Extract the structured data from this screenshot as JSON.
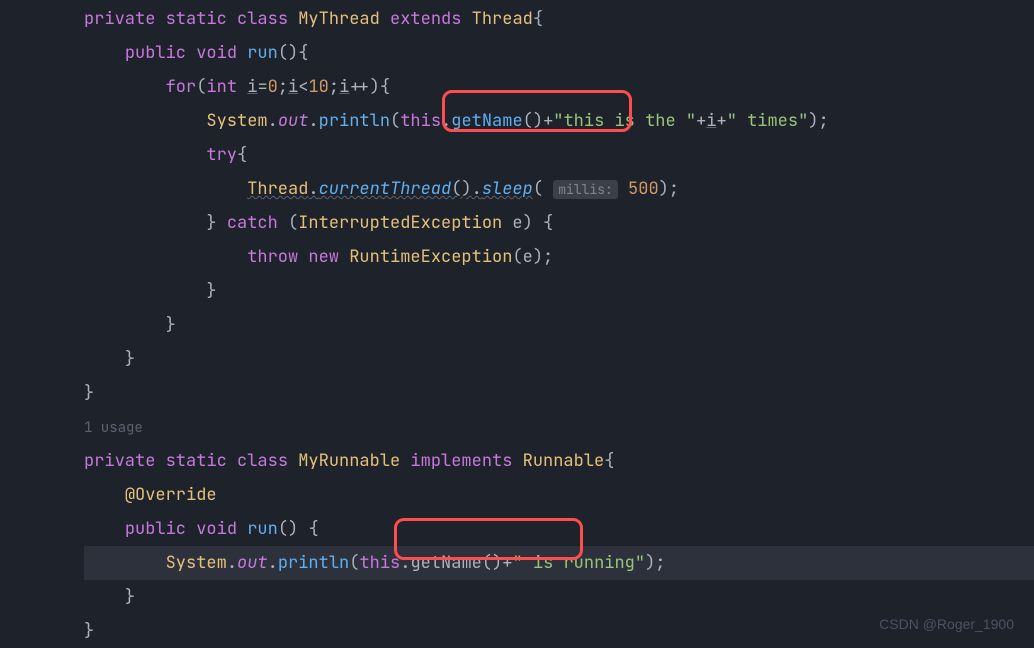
{
  "code": {
    "l1_private": "private",
    "l1_static": "static",
    "l1_class": "class",
    "l1_mythread": "MyThread",
    "l1_extends": "extends",
    "l1_thread": "Thread",
    "l1_brace": "{",
    "l2_public": "public",
    "l2_void": "void",
    "l2_run": "run",
    "l2_parens": "(){",
    "l3_for": "for",
    "l3_int": "int",
    "l3_i": "i",
    "l3_eq": "=",
    "l3_zero": "0",
    "l3_sc1": ";",
    "l3_i2": "i",
    "l3_lt": "<",
    "l3_ten": "10",
    "l3_sc2": ";",
    "l3_i3": "i",
    "l3_pp": "++){",
    "l4_system": "System",
    "l4_dot1": ".",
    "l4_out": "out",
    "l4_dot2": ".",
    "l4_println": "println",
    "l4_open": "(",
    "l4_this": "this",
    "l4_dot3": ".",
    "l4_getname": "getName",
    "l4_call": "()",
    "l4_plus1": "+",
    "l4_str1": "\"this is the \"",
    "l4_plus2": "+",
    "l4_i": "i",
    "l4_plus3": "+",
    "l4_str2": "\" times\"",
    "l4_close": ");",
    "l5_try": "try",
    "l5_brace": "{",
    "l6_thread": "Thread",
    "l6_dot1": ".",
    "l6_current": "currentThread",
    "l6_call1": "()",
    "l6_dot2": ".",
    "l6_sleep": "sleep",
    "l6_open": "(",
    "l6_millis": "millis:",
    "l6_space": " ",
    "l6_500": "500",
    "l6_close": ");",
    "l7_close": "}",
    "l7_catch": "catch",
    "l7_open": "(",
    "l7_exc": "InterruptedException",
    "l7_e": " e) {",
    "l8_throw": "throw",
    "l8_new": "new",
    "l8_rte": "RuntimeException",
    "l8_call": "(e);",
    "l9_close": "}",
    "l10_close": "}",
    "l11_close": "}",
    "l12_close": "}",
    "usage": "1 usage",
    "l13_private": "private",
    "l13_static": "static",
    "l13_class": "class",
    "l13_myrun": "MyRunnable",
    "l13_impl": "implements",
    "l13_runnable": "Runnable",
    "l13_brace": "{",
    "l14_override": "@Override",
    "l15_public": "public",
    "l15_void": "void",
    "l15_run": "run",
    "l15_parens": "() {",
    "l16_system": "System",
    "l16_dot1": ".",
    "l16_out": "out",
    "l16_dot2": ".",
    "l16_println": "println",
    "l16_open": "(",
    "l16_this": "this",
    "l16_dot3": ".",
    "l16_getname": "getName",
    "l16_call": "()",
    "l16_plus": "+",
    "l16_str": "\" is running\"",
    "l16_close": ");",
    "l17_close": "}",
    "l18_close": "}"
  },
  "watermark": "CSDN @Roger_1900"
}
